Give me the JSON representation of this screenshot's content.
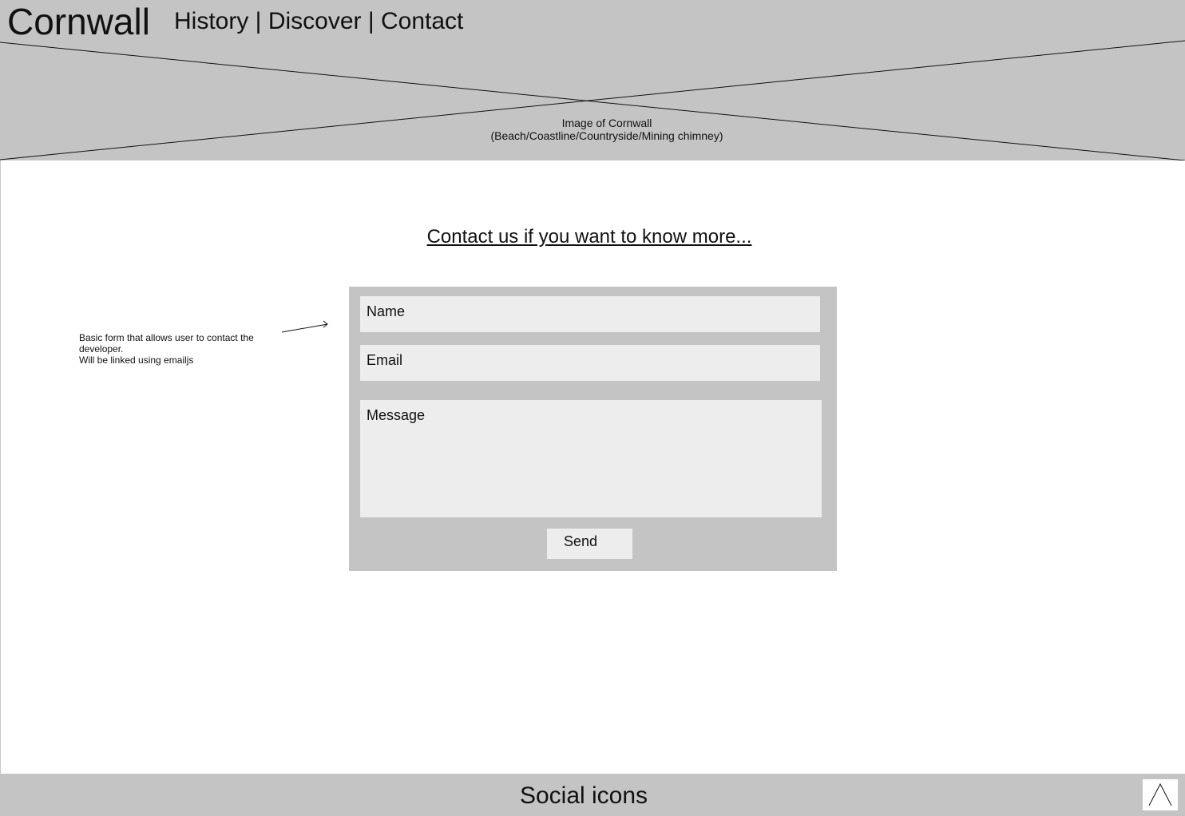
{
  "header": {
    "brand": "Cornwall",
    "nav": {
      "history": "History",
      "separator": " | ",
      "discover": "Discover",
      "contact": "Contact"
    },
    "hero_image_caption_line1": "Image of Cornwall",
    "hero_image_caption_line2": "(Beach/Coastline/Countryside/Mining chimney)"
  },
  "main": {
    "section_title": "Contact us if you want to know more...",
    "annotation": {
      "line1": "Basic form that allows user to contact the developer.",
      "line2": "Will be linked using emailjs"
    },
    "form": {
      "name_placeholder": "Name",
      "email_placeholder": "Email",
      "message_placeholder": "Message",
      "send_label": "Send"
    }
  },
  "footer": {
    "social_label": "Social icons",
    "back_to_top_icon": "caret-up-icon"
  },
  "colors": {
    "placeholder_gray": "#c4c4c4",
    "field_gray": "#ededed",
    "background": "#ffffff"
  }
}
